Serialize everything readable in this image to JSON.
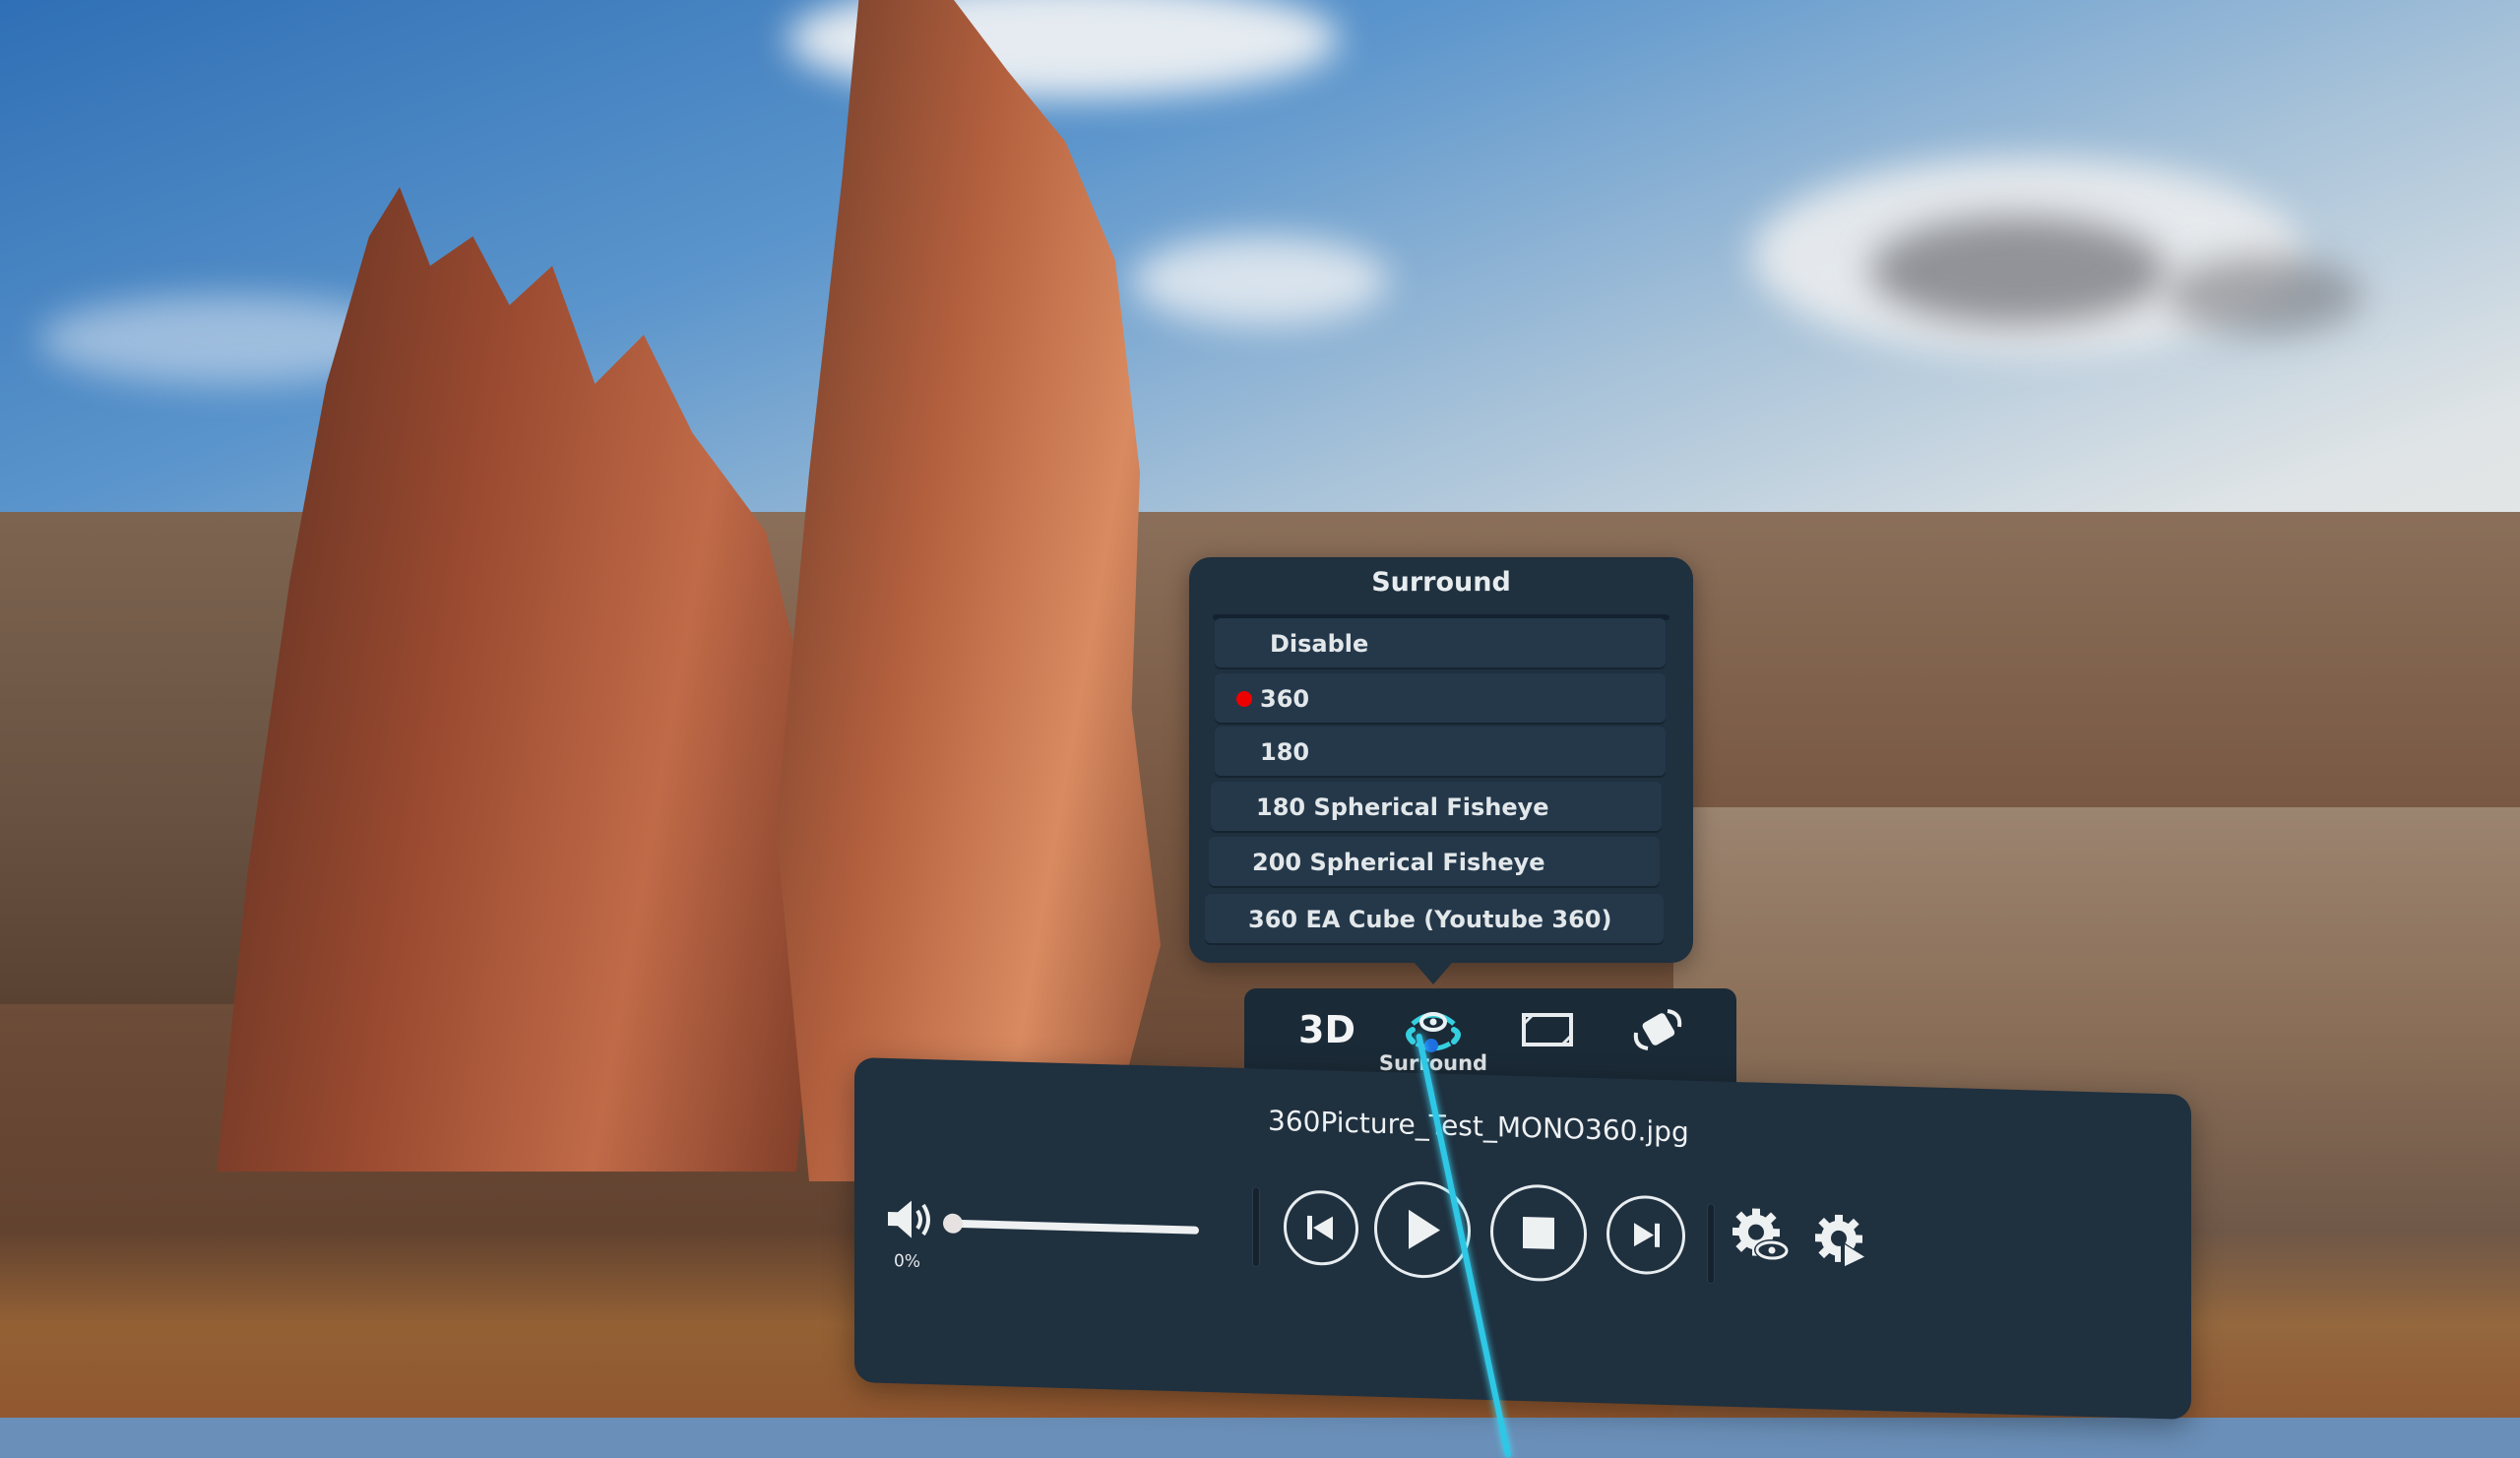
{
  "surround_menu": {
    "title": "Surround",
    "options": [
      {
        "label": "Disable",
        "selected": false
      },
      {
        "label": "360",
        "selected": true
      },
      {
        "label": "180",
        "selected": false
      },
      {
        "label": "180 Spherical Fisheye",
        "selected": false
      },
      {
        "label": "200 Spherical Fisheye",
        "selected": false
      },
      {
        "label": "360 EA Cube (Youtube 360)",
        "selected": false
      }
    ],
    "selected_indicator_color": "#ee0000"
  },
  "mode_bar": {
    "three_d_label": "3D",
    "surround_icon": "surround-eye-icon",
    "surround_caption": "Surround",
    "flat_icon": "screen-frame-icon",
    "rotate_icon": "rotate-icon",
    "active_color": "#35d0e0"
  },
  "player": {
    "filename": "360Picture_Test_MONO360.jpg",
    "volume": {
      "icon": "speaker-icon",
      "percent_label": "0%",
      "value": 0
    },
    "controls": [
      {
        "name": "previous",
        "icon": "skip-previous-icon"
      },
      {
        "name": "play",
        "icon": "play-icon"
      },
      {
        "name": "stop",
        "icon": "stop-icon"
      },
      {
        "name": "next",
        "icon": "skip-next-icon"
      }
    ],
    "settings": [
      {
        "name": "view-settings",
        "icon": "gear-eye-icon"
      },
      {
        "name": "playback-settings",
        "icon": "gear-play-icon"
      }
    ]
  },
  "pointer": {
    "color": "#2ec7e6"
  }
}
